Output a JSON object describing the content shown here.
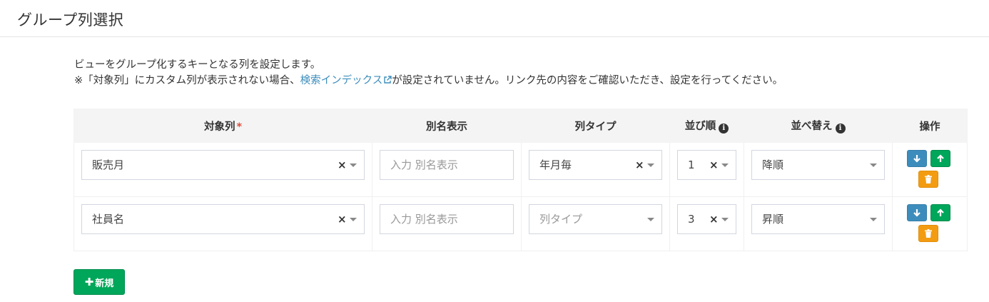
{
  "page": {
    "title": "グループ列選択"
  },
  "description": {
    "line1": "ビューをグループ化するキーとなる列を設定します。",
    "line2_prefix": "※「対象列」にカスタム列が表示されない場合、",
    "line2_link": "検索インデックス",
    "line2_suffix": "が設定されていません。リンク先の内容をご確認いただき、設定を行ってください。"
  },
  "table": {
    "headers": {
      "target_column": "対象列",
      "required_mark": "*",
      "alias": "別名表示",
      "column_type": "列タイプ",
      "order": "並び順",
      "sort": "並べ替え",
      "actions": "操作"
    },
    "rows": [
      {
        "target": "販売月",
        "alias_placeholder": "入力 別名表示",
        "column_type": "年月毎",
        "order": "1",
        "sort": "降順"
      },
      {
        "target": "社員名",
        "alias_placeholder": "入力 別名表示",
        "column_type": "列タイプ",
        "order": "3",
        "sort": "昇順"
      }
    ],
    "clear_symbol": "×"
  },
  "buttons": {
    "new_label": "新規",
    "plus_symbol": "✚"
  },
  "icons": {
    "info": "info-circle-icon",
    "down": "arrow-down-icon",
    "up": "arrow-up-icon",
    "delete": "trash-icon",
    "external": "external-link-icon"
  },
  "colors": {
    "primary": "#3c8dbc",
    "success": "#00a65a",
    "warning": "#f39c12",
    "required": "#dd4b39"
  }
}
